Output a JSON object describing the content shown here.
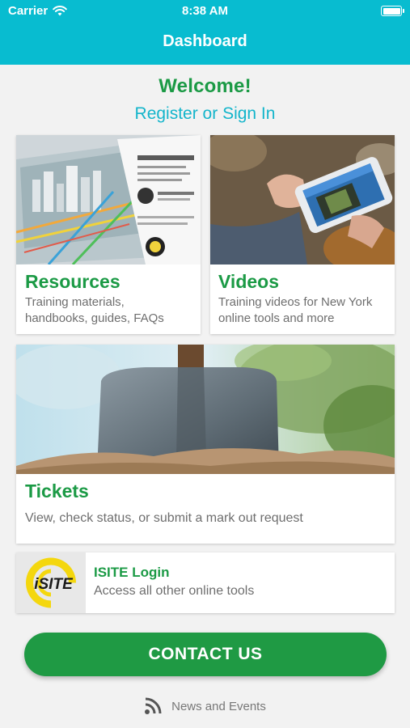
{
  "status_bar": {
    "carrier": "Carrier",
    "time": "8:38 AM"
  },
  "header": {
    "title": "Dashboard"
  },
  "welcome": {
    "heading": "Welcome!",
    "register_link": "Register or Sign In"
  },
  "cards": {
    "resources": {
      "title": "Resources",
      "desc_line1": "Training materials,",
      "desc_line2": "handbooks, guides, FAQs"
    },
    "videos": {
      "title": "Videos",
      "desc_line1": "Training videos for New York",
      "desc_line2": "online tools and more"
    },
    "tickets": {
      "title": "Tickets",
      "desc": "View, check status, or submit a mark out request"
    },
    "isite": {
      "title": "ISITE Login",
      "desc": "Access all other online tools",
      "logo_text": "iSITE"
    }
  },
  "contact_button": {
    "label": "CONTACT US"
  },
  "footer": {
    "news_label": "News and Events"
  },
  "colors": {
    "header": "#08bcd0",
    "brand_green": "#1b9a45",
    "link": "#14b5cb"
  }
}
